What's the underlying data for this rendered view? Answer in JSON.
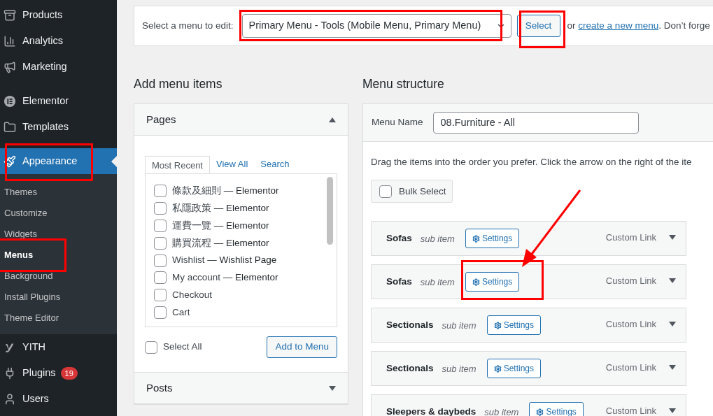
{
  "sidebar": {
    "items": [
      {
        "label": "Products",
        "selected": false
      },
      {
        "label": "Analytics",
        "selected": false
      },
      {
        "label": "Marketing",
        "selected": false
      },
      {
        "label": "Elementor",
        "selected": false
      },
      {
        "label": "Templates",
        "selected": false
      },
      {
        "label": "Appearance",
        "selected": true,
        "children": [
          {
            "label": "Themes",
            "selected": false
          },
          {
            "label": "Customize",
            "selected": false
          },
          {
            "label": "Widgets",
            "selected": false
          },
          {
            "label": "Menus",
            "selected": true
          },
          {
            "label": "Background",
            "selected": false
          },
          {
            "label": "Install Plugins",
            "selected": false
          },
          {
            "label": "Theme Editor",
            "selected": false
          }
        ]
      },
      {
        "label": "YITH",
        "selected": false
      },
      {
        "label": "Plugins",
        "selected": false,
        "badge": "19"
      },
      {
        "label": "Users",
        "selected": false
      }
    ]
  },
  "menu_picker": {
    "label": "Select a menu to edit:",
    "value": "Primary Menu - Tools (Mobile Menu, Primary Menu)",
    "button": "Select",
    "text_before_link": "or",
    "link": "create a new menu",
    "text_after_link": ". Don’t forge"
  },
  "add_menu_items": {
    "title": "Add menu items",
    "panels": [
      {
        "title": "Pages",
        "expanded": true,
        "tabs": [
          {
            "label": "Most Recent",
            "selected": true
          },
          {
            "label": "View All",
            "selected": false
          },
          {
            "label": "Search",
            "selected": false
          }
        ],
        "items": [
          {
            "name": "條款及細則",
            "type": "— Elementor",
            "checked": false
          },
          {
            "name": "私隱政策",
            "type": "— Elementor",
            "checked": false
          },
          {
            "name": "運費一覽",
            "type": "— Elementor",
            "checked": false
          },
          {
            "name": "購買流程",
            "type": "— Elementor",
            "checked": false
          },
          {
            "name": "Wishlist",
            "type": "— Wishlist Page",
            "checked": false
          },
          {
            "name": "My account",
            "type": "— Elementor",
            "checked": false
          },
          {
            "name": "Checkout",
            "checked": false
          },
          {
            "name": "Cart",
            "checked": false
          }
        ],
        "select_all": {
          "label": "Select All",
          "checked": false
        },
        "button": "Add to Menu"
      },
      {
        "title": "Posts",
        "expanded": false
      }
    ]
  },
  "menu_structure": {
    "title": "Menu structure",
    "menu_name_label": "Menu Name",
    "menu_name": "08.Furniture - All",
    "instructions": "Drag the items into the order you prefer. Click the arrow on the right of the ite",
    "bulk_select": {
      "label": "Bulk Select",
      "checked": false
    },
    "items": [
      {
        "title": "Sofas",
        "subtitle": "sub item",
        "button": "Settings",
        "type": "Custom Link"
      },
      {
        "title": "Sofas",
        "subtitle": "sub item",
        "button": "Settings",
        "type": "Custom Link"
      },
      {
        "title": "Sectionals",
        "subtitle": "sub item",
        "button": "Settings",
        "type": "Custom Link"
      },
      {
        "title": "Sectionals",
        "subtitle": "sub item",
        "button": "Settings",
        "type": "Custom Link"
      },
      {
        "title": "Sleepers & daybeds",
        "subtitle": "sub item",
        "button": "Settings",
        "type": "Custom Link"
      }
    ]
  }
}
